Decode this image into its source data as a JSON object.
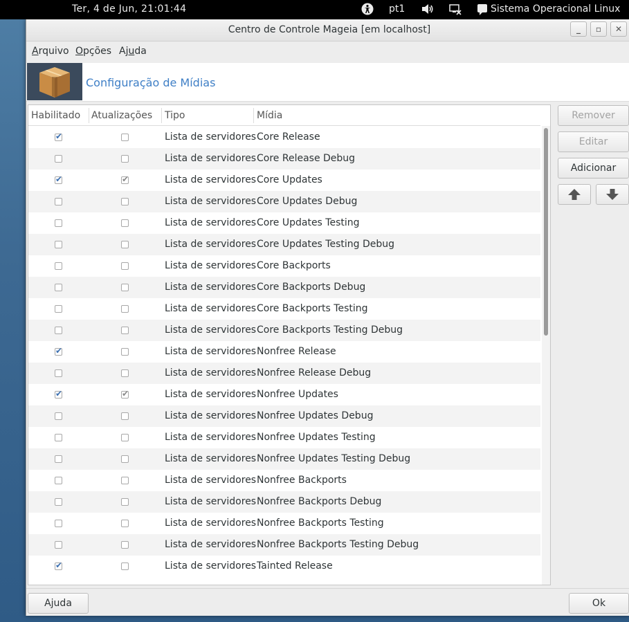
{
  "top_panel": {
    "clock": "Ter,  4 de Jun, 21:01:44",
    "keyboard_layout": "pt1",
    "user_label": "Sistema Operacional Linux"
  },
  "window": {
    "title": "Centro de Controle Mageia  [em localhost]",
    "controls": {
      "minimize": "_",
      "maximize": "▫",
      "close": "✕"
    }
  },
  "menubar": {
    "arquivo": {
      "pre": "",
      "u": "A",
      "post": "rquivo"
    },
    "opcoes": {
      "pre": "",
      "u": "O",
      "post": "pções"
    },
    "ajuda": {
      "pre": "Aj",
      "u": "u",
      "post": "da"
    }
  },
  "header": {
    "title": "Configuração de Mídias",
    "icon": "package-box-icon"
  },
  "table": {
    "columns": [
      "Habilitado",
      "Atualizações",
      "Tipo",
      "Mídia"
    ],
    "rows": [
      {
        "enabled": true,
        "updates": false,
        "tipo": "Lista de servidores",
        "midia": "Core Release"
      },
      {
        "enabled": false,
        "updates": false,
        "tipo": "Lista de servidores",
        "midia": "Core Release Debug"
      },
      {
        "enabled": true,
        "updates": true,
        "tipo": "Lista de servidores",
        "midia": "Core Updates"
      },
      {
        "enabled": false,
        "updates": false,
        "tipo": "Lista de servidores",
        "midia": "Core Updates Debug"
      },
      {
        "enabled": false,
        "updates": false,
        "tipo": "Lista de servidores",
        "midia": "Core Updates Testing"
      },
      {
        "enabled": false,
        "updates": false,
        "tipo": "Lista de servidores",
        "midia": "Core Updates Testing Debug"
      },
      {
        "enabled": false,
        "updates": false,
        "tipo": "Lista de servidores",
        "midia": "Core Backports"
      },
      {
        "enabled": false,
        "updates": false,
        "tipo": "Lista de servidores",
        "midia": "Core Backports Debug"
      },
      {
        "enabled": false,
        "updates": false,
        "tipo": "Lista de servidores",
        "midia": "Core Backports Testing"
      },
      {
        "enabled": false,
        "updates": false,
        "tipo": "Lista de servidores",
        "midia": "Core Backports Testing Debug"
      },
      {
        "enabled": true,
        "updates": false,
        "tipo": "Lista de servidores",
        "midia": "Nonfree Release"
      },
      {
        "enabled": false,
        "updates": false,
        "tipo": "Lista de servidores",
        "midia": "Nonfree Release Debug"
      },
      {
        "enabled": true,
        "updates": true,
        "tipo": "Lista de servidores",
        "midia": "Nonfree Updates"
      },
      {
        "enabled": false,
        "updates": false,
        "tipo": "Lista de servidores",
        "midia": "Nonfree Updates Debug"
      },
      {
        "enabled": false,
        "updates": false,
        "tipo": "Lista de servidores",
        "midia": "Nonfree Updates Testing"
      },
      {
        "enabled": false,
        "updates": false,
        "tipo": "Lista de servidores",
        "midia": "Nonfree Updates Testing Debug"
      },
      {
        "enabled": false,
        "updates": false,
        "tipo": "Lista de servidores",
        "midia": "Nonfree Backports"
      },
      {
        "enabled": false,
        "updates": false,
        "tipo": "Lista de servidores",
        "midia": "Nonfree Backports Debug"
      },
      {
        "enabled": false,
        "updates": false,
        "tipo": "Lista de servidores",
        "midia": "Nonfree Backports Testing"
      },
      {
        "enabled": false,
        "updates": false,
        "tipo": "Lista de servidores",
        "midia": "Nonfree Backports Testing Debug"
      },
      {
        "enabled": true,
        "updates": false,
        "tipo": "Lista de servidores",
        "midia": "Tainted Release"
      }
    ]
  },
  "side_buttons": {
    "remove": "Remover",
    "edit": "Editar",
    "add": "Adicionar"
  },
  "footer": {
    "help": "Ajuda",
    "ok": "Ok"
  },
  "colors": {
    "accent": "#3f7fc6",
    "checked_blue": "#3b6fb0"
  }
}
